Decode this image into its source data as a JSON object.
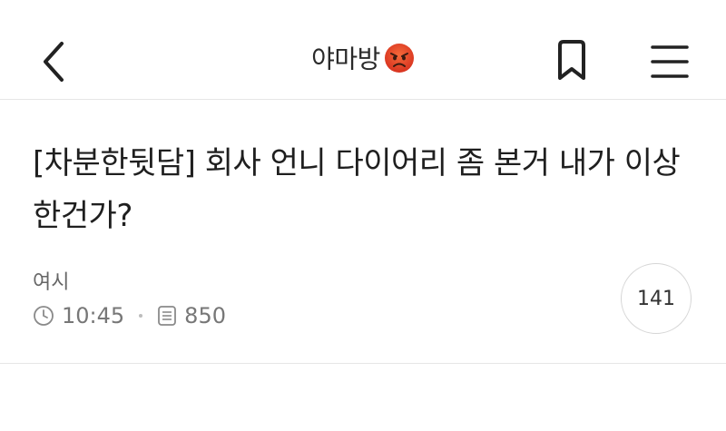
{
  "header": {
    "back_icon": "chevron-left-icon",
    "title": "야마방",
    "title_emoji": "angry-face-emoji",
    "bookmark_icon": "bookmark-icon",
    "menu_icon": "hamburger-menu-icon"
  },
  "post": {
    "title": "[차분한뒷담] 회사 언니 다이어리 좀 본거 내가 이상한건가?",
    "author": "여시",
    "time": "10:45",
    "views": "850",
    "comment_count": "141"
  },
  "colors": {
    "text_primary": "#1f1f1f",
    "text_meta": "#777777",
    "divider": "#e6e6e6",
    "emoji_red": "#e8442b"
  }
}
